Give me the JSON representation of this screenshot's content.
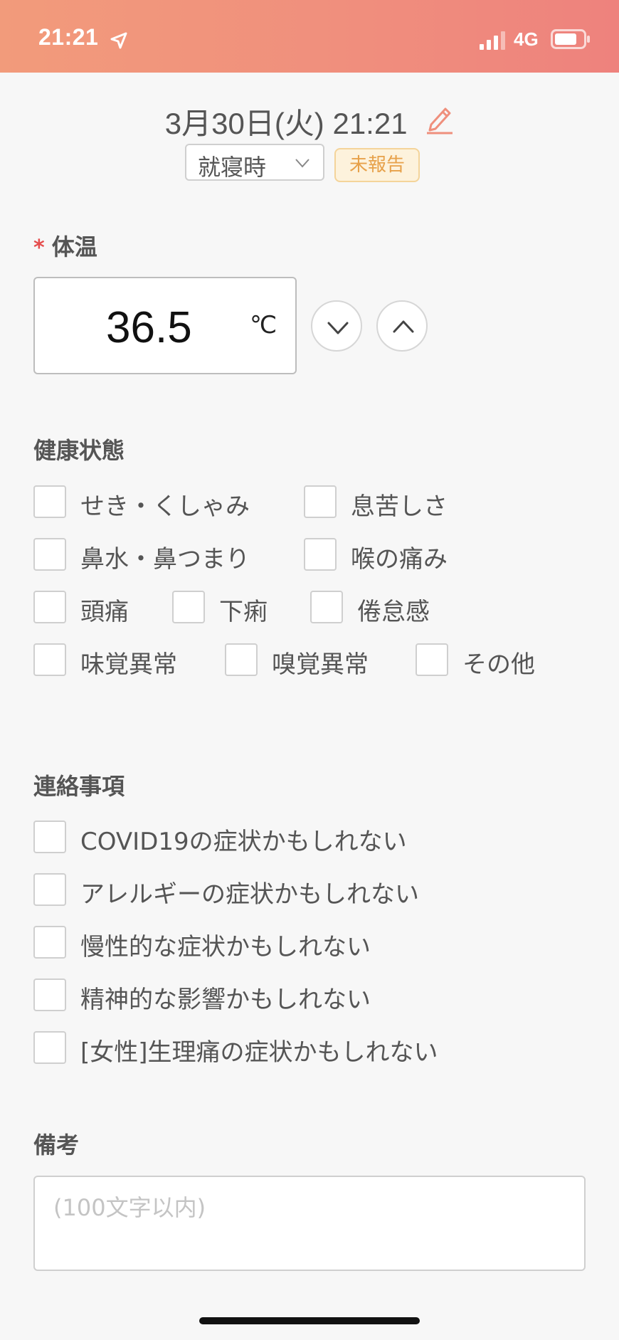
{
  "status_bar": {
    "time": "21:21",
    "network": "4G"
  },
  "header": {
    "datetime": "3月30日(火) 21:21",
    "timing_select_value": "就寝時",
    "report_status": "未報告"
  },
  "temperature": {
    "required_mark": "*",
    "title": "体温",
    "value": "36.5",
    "unit": "℃"
  },
  "health": {
    "title": "健康状態",
    "options": [
      "せき・くしゃみ",
      "息苦しさ",
      "鼻水・鼻つまり",
      "喉の痛み",
      "頭痛",
      "下痢",
      "倦怠感",
      "味覚異常",
      "嗅覚異常",
      "その他"
    ]
  },
  "contact": {
    "title": "連絡事項",
    "options": [
      "COVID19の症状かもしれない",
      "アレルギーの症状かもしれない",
      "慢性的な症状かもしれない",
      "精神的な影響かもしれない",
      "[女性]生理痛の症状かもしれない"
    ]
  },
  "notes": {
    "title": "備考",
    "placeholder": "(100文字以内)"
  },
  "colors": {
    "accent": "#ef8f7c",
    "required": "#e54d4d",
    "badge_text": "#e7a14a",
    "badge_bg": "#fdf2dc"
  }
}
